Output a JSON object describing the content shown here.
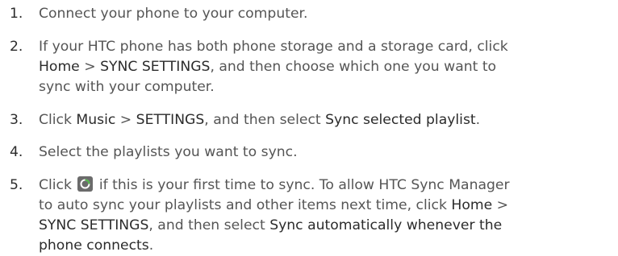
{
  "steps": [
    {
      "number": "1.",
      "text": "Connect your phone to your computer."
    },
    {
      "number": "2.",
      "lines": [
        {
          "parts": [
            {
              "t": "If your HTC phone has both phone storage and a storage card, click",
              "b": false
            }
          ]
        },
        {
          "parts": [
            {
              "t": "Home",
              "b": true
            },
            {
              "t": " > ",
              "b": false
            },
            {
              "t": "SYNC SETTINGS",
              "b": true
            },
            {
              "t": ", and then choose which one you want to",
              "b": false
            }
          ]
        },
        {
          "parts": [
            {
              "t": "sync with your computer.",
              "b": false
            }
          ]
        }
      ]
    },
    {
      "number": "3.",
      "parts": [
        {
          "t": "Click ",
          "b": false
        },
        {
          "t": "Music",
          "b": true
        },
        {
          "t": " > ",
          "b": false
        },
        {
          "t": "SETTINGS",
          "b": true
        },
        {
          "t": ", and then select ",
          "b": false
        },
        {
          "t": "Sync selected playlist",
          "b": true
        },
        {
          "t": ".",
          "b": false
        }
      ]
    },
    {
      "number": "4.",
      "text": "Select the playlists you want to sync."
    },
    {
      "number": "5.",
      "line1": {
        "before_icon": "Click ",
        "icon": "sync-button-icon",
        "after_icon": " if this is your first time to sync. To allow HTC Sync Manager"
      },
      "lines": [
        {
          "parts": [
            {
              "t": "to auto sync your playlists and other items next time, click ",
              "b": false
            },
            {
              "t": "Home",
              "b": true
            },
            {
              "t": " >",
              "b": false
            }
          ]
        },
        {
          "parts": [
            {
              "t": "SYNC SETTINGS",
              "b": true
            },
            {
              "t": ", and then select ",
              "b": false
            },
            {
              "t": "Sync automatically whenever the",
              "b": true
            }
          ]
        },
        {
          "parts": [
            {
              "t": "phone connects",
              "b": true
            },
            {
              "t": ".",
              "b": false
            }
          ]
        }
      ]
    }
  ],
  "colors": {
    "body_text": "#555555",
    "bold_text": "#2b2b2b",
    "icon_bg": "#6b6b6b",
    "icon_fg": "#ffffff",
    "icon_accent": "#4fb848"
  }
}
